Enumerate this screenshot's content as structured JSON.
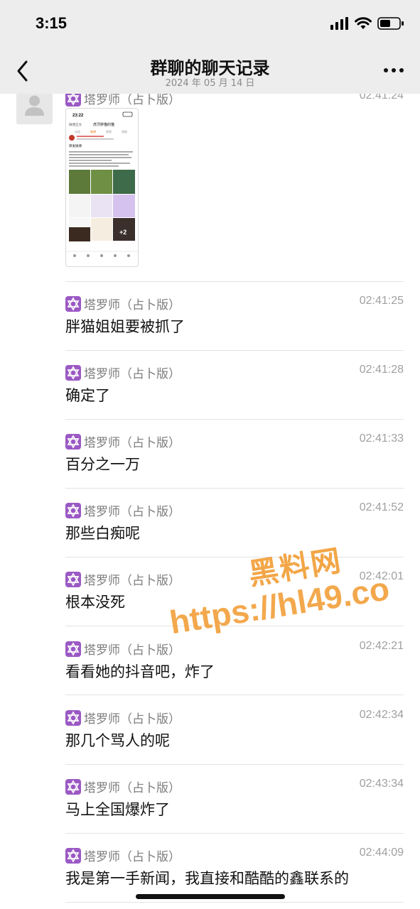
{
  "status_bar": {
    "time": "3:15",
    "icons": [
      "signal-icon",
      "wifi-icon",
      "battery-icon"
    ]
  },
  "nav": {
    "back_icon": "chevron-left-icon",
    "title": "群聊的聊天记录",
    "subtitle": "2024 年 05 月 14 日",
    "more_icon": "more-icon"
  },
  "messages": [
    {
      "sender": "塔罗师（占卜版）",
      "time": "02:41:24",
      "type": "image",
      "text": ""
    },
    {
      "sender": "塔罗师（占卜版）",
      "time": "02:41:25",
      "type": "text",
      "text": "胖猫姐姐要被抓了"
    },
    {
      "sender": "塔罗师（占卜版）",
      "time": "02:41:28",
      "type": "text",
      "text": "确定了"
    },
    {
      "sender": "塔罗师（占卜版）",
      "time": "02:41:33",
      "type": "text",
      "text": "百分之一万"
    },
    {
      "sender": "塔罗师（占卜版）",
      "time": "02:41:52",
      "type": "text",
      "text": "那些白痴呢"
    },
    {
      "sender": "塔罗师（占卜版）",
      "time": "02:42:01",
      "type": "text",
      "text": "根本没死"
    },
    {
      "sender": "塔罗师（占卜版）",
      "time": "02:42:21",
      "type": "text",
      "text": "看看她的抖音吧，炸了"
    },
    {
      "sender": "塔罗师（占卜版）",
      "time": "02:42:34",
      "type": "text",
      "text": "那几个骂人的呢"
    },
    {
      "sender": "塔罗师（占卜版）",
      "time": "02:43:34",
      "type": "text",
      "text": "马上全国爆炸了"
    },
    {
      "sender": "塔罗师（占卜版）",
      "time": "02:44:09",
      "type": "text",
      "text": "我是第一手新闻，我直接和酷酷的鑫联系的"
    }
  ],
  "thumbnail": {
    "time": "23:22",
    "back_label": "微博正文",
    "header": "虎牙胖猫的猫",
    "tabs": [
      "动态",
      "微博",
      "视频",
      "相册"
    ],
    "section": "转发微博",
    "badge": "+2"
  },
  "watermark": {
    "brand": "黑料网",
    "url": "https://hl49.co"
  },
  "colors": {
    "header_bg": "#ededed",
    "divider": "#e3e3e3",
    "tarot_icon": "#9b59c4",
    "watermark": "#f29a2e"
  }
}
